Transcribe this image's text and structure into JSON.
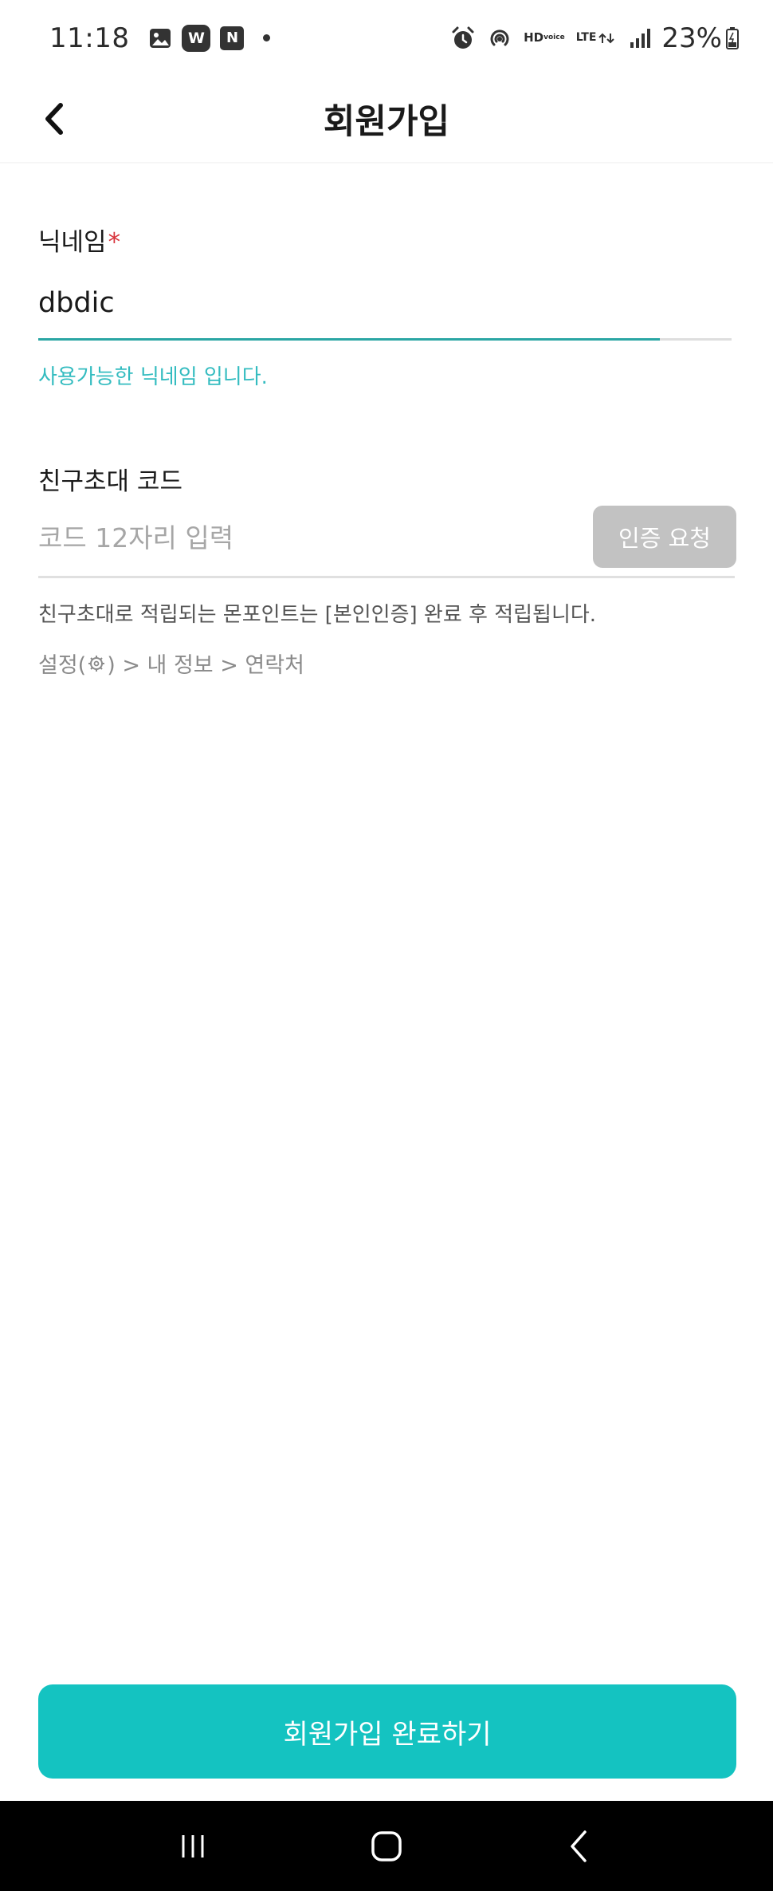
{
  "status_bar": {
    "time": "11:18",
    "notification_icons": [
      "gallery-icon",
      "w-app-icon",
      "n-app-icon"
    ],
    "w_badge": "W",
    "n_badge": "N",
    "hd_label": "HD",
    "voice_label": "voice",
    "lte_label": "LTE",
    "battery": "23%"
  },
  "header": {
    "title": "회원가입",
    "back_icon": "chevron-left-icon"
  },
  "nickname": {
    "label": "닉네임",
    "required_mark": "*",
    "value": "dbdic",
    "status_message": "사용가능한 닉네임 입니다."
  },
  "invite": {
    "label": "친구초대 코드",
    "placeholder": "코드 12자리 입력",
    "verify_button": "인증 요청",
    "info": "친구초대로 적립되는 몬포인트는 [본인인증] 완료 후 적립됩니다.",
    "path_prefix": "설정(",
    "path_suffix": ") > 내 정보 > 연락처"
  },
  "submit_button": "회원가입 완료하기",
  "colors": {
    "accent": "#14c3c1",
    "success_text": "#34bcc0",
    "input_focus_line": "#2aa6a4",
    "disabled_button": "#c2c2c2",
    "required": "#d8343c"
  }
}
